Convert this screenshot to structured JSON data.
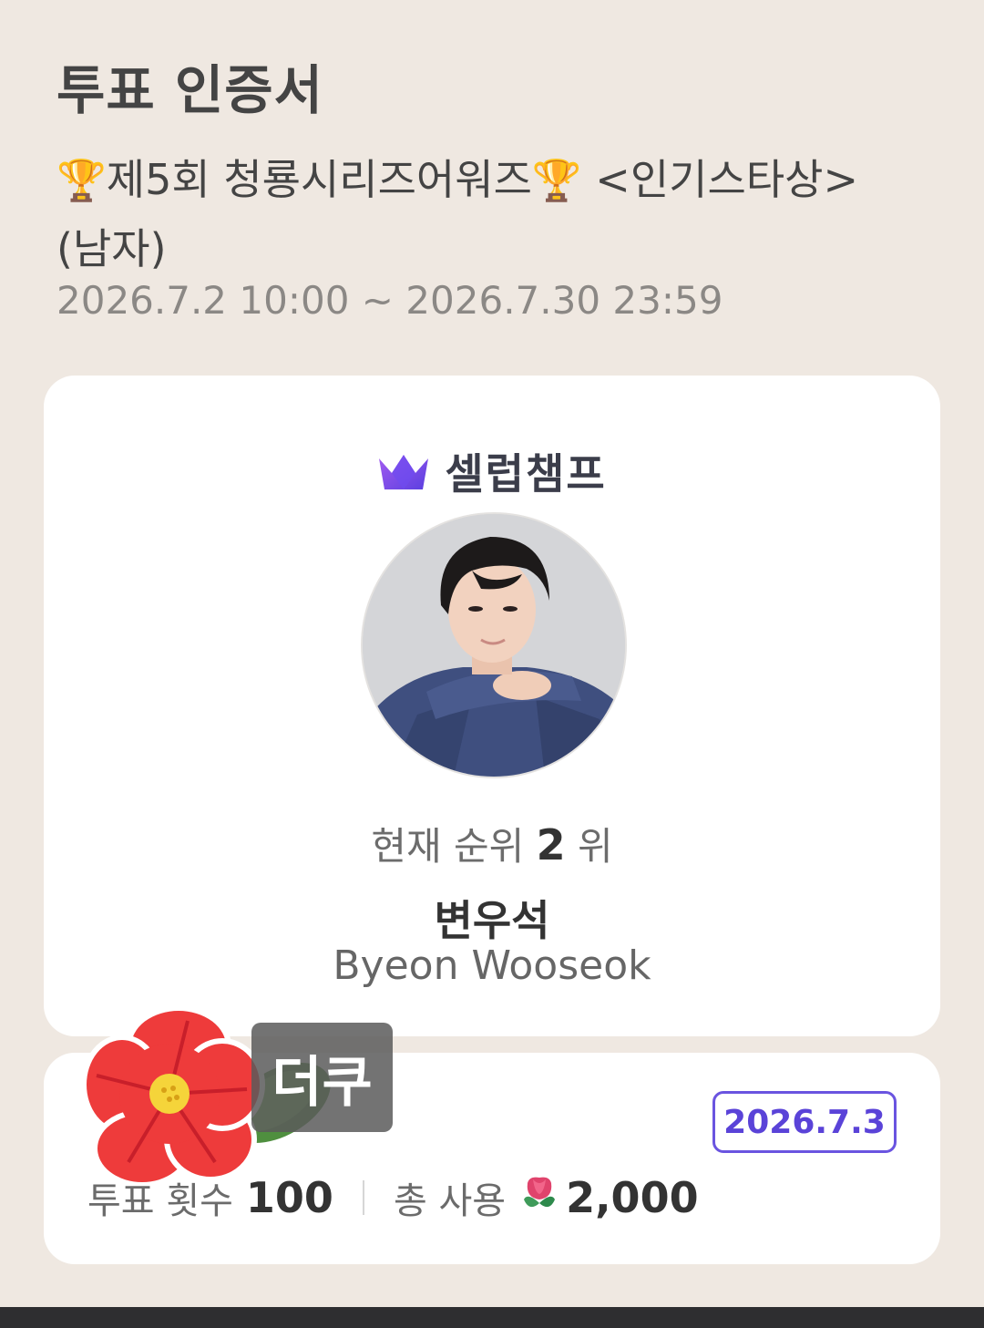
{
  "header": {
    "title": "투표 인증서",
    "event_name": "제5회 청룡시리즈어워즈",
    "event_suffix": " <인기스타상> (남자)",
    "period": "2026.7.2 10:00 ~ 2026.7.30 23:59",
    "trophy_icon": "🏆"
  },
  "card": {
    "brand": "셀럽챔프",
    "rank_prefix": "현재 순위",
    "rank_value": "2",
    "rank_suffix": "위",
    "name_ko": "변우석",
    "name_en": "Byeon Wooseok"
  },
  "summary": {
    "date": "2026.7.3",
    "vote_count_label": "투표 횟수",
    "vote_count": "100",
    "total_used_label": "총 사용",
    "total_used": "2,000"
  },
  "sticker": {
    "text": "더쿠"
  },
  "colors": {
    "background": "#efe8e1",
    "accent": "#5a43d8",
    "brand_crown": "#7b4ee8"
  }
}
